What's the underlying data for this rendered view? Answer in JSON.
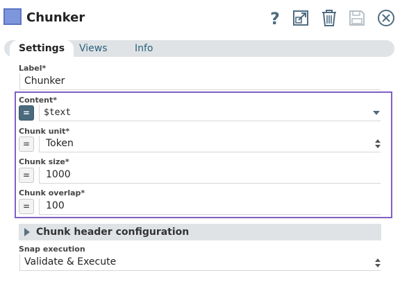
{
  "header": {
    "title": "Chunker",
    "icons": [
      "help-icon",
      "export-icon",
      "delete-icon",
      "save-icon",
      "close-icon"
    ],
    "node_color": "#7e96dc"
  },
  "tabs": [
    {
      "label": "Settings",
      "active": true
    },
    {
      "label": "Views",
      "active": false
    },
    {
      "label": "Info",
      "active": false
    }
  ],
  "fields": {
    "label": {
      "label": "Label*",
      "value": "Chunker"
    },
    "content": {
      "label": "Content*",
      "value": "$text",
      "expression_enabled": true
    },
    "chunk_unit": {
      "label": "Chunk unit*",
      "value": "Token"
    },
    "chunk_size": {
      "label": "Chunk size*",
      "value": "1000"
    },
    "chunk_overlap": {
      "label": "Chunk overlap*",
      "value": "100"
    }
  },
  "expression_toggle_symbol": "=",
  "section": {
    "title": "Chunk header configuration",
    "collapsed": true
  },
  "snap_execution": {
    "label": "Snap execution",
    "value": "Validate & Execute"
  },
  "colors": {
    "accent": "#7e5fc4",
    "tab_bg": "#dfe3e6",
    "expr_on": "#4a6a7e"
  }
}
